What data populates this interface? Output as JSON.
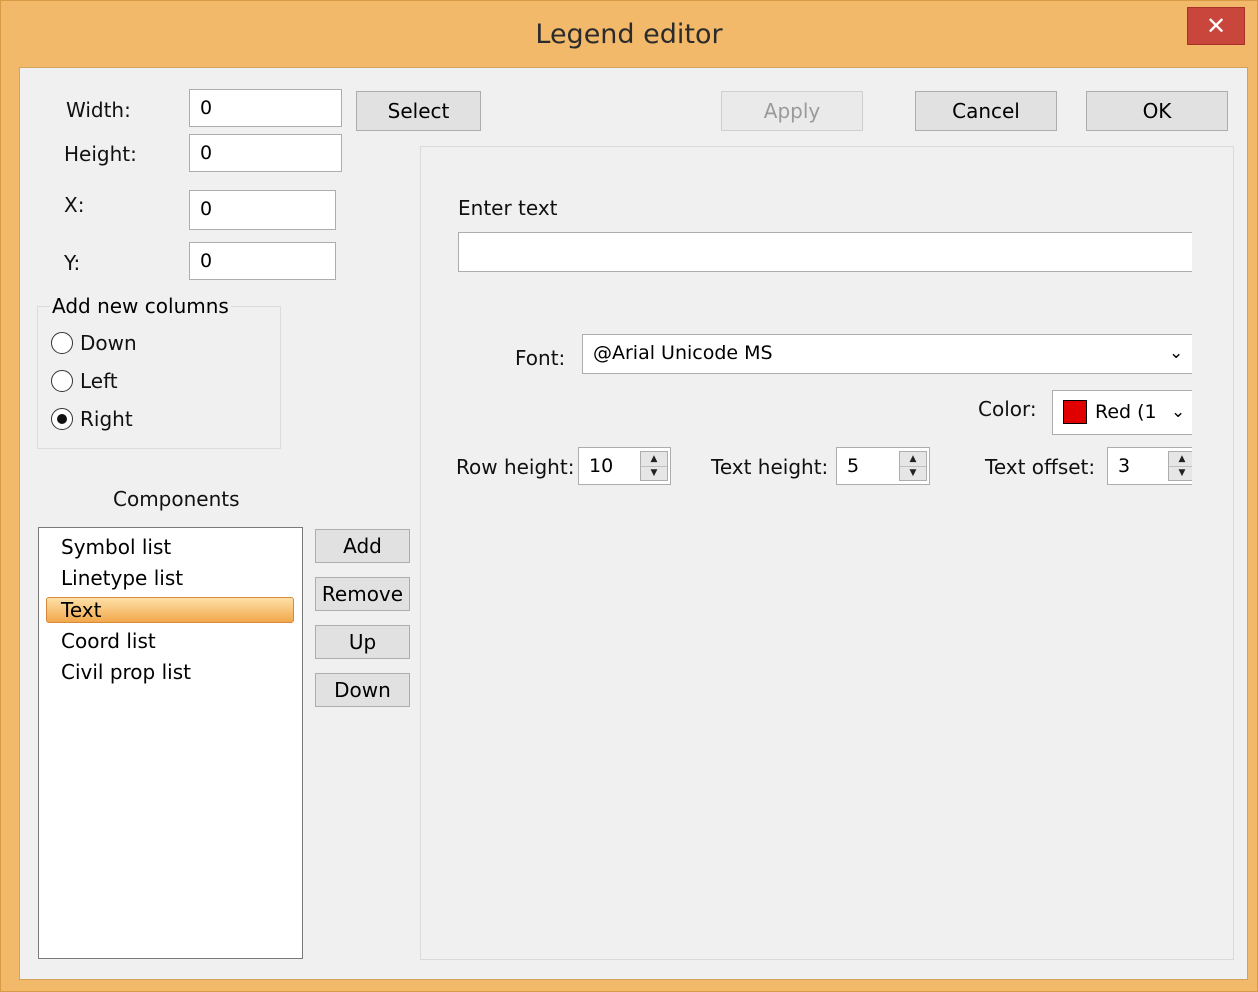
{
  "window": {
    "title": "Legend editor",
    "close_glyph": "✕"
  },
  "toolbar": {
    "select_label": "Select",
    "apply_label": "Apply",
    "cancel_label": "Cancel",
    "ok_label": "OK"
  },
  "geometry": {
    "width_label": "Width:",
    "width_value": "0",
    "height_label": "Height:",
    "height_value": "0",
    "x_label": "X:",
    "x_value": "0",
    "y_label": "Y:",
    "y_value": "0"
  },
  "columns": {
    "group_label": "Add new columns",
    "options": [
      {
        "label": "Down",
        "checked": false
      },
      {
        "label": "Left",
        "checked": false
      },
      {
        "label": "Right",
        "checked": true
      }
    ]
  },
  "components": {
    "heading": "Components",
    "items": [
      "Symbol list",
      "Linetype list",
      "Text",
      "Coord list",
      "Civil prop list"
    ],
    "selected": "Text",
    "add_label": "Add",
    "remove_label": "Remove",
    "up_label": "Up",
    "down_label": "Down"
  },
  "text_panel": {
    "enter_text_label": "Enter text",
    "enter_text_value": "",
    "font_label": "Font:",
    "font_value": "@Arial Unicode MS",
    "color_label": "Color:",
    "color_value": "Red (1",
    "color_swatch": "#e00000",
    "row_height_label": "Row height:",
    "row_height_value": "10",
    "text_height_label": "Text height:",
    "text_height_value": "5",
    "text_offset_label": "Text offset:",
    "text_offset_value": "3"
  }
}
